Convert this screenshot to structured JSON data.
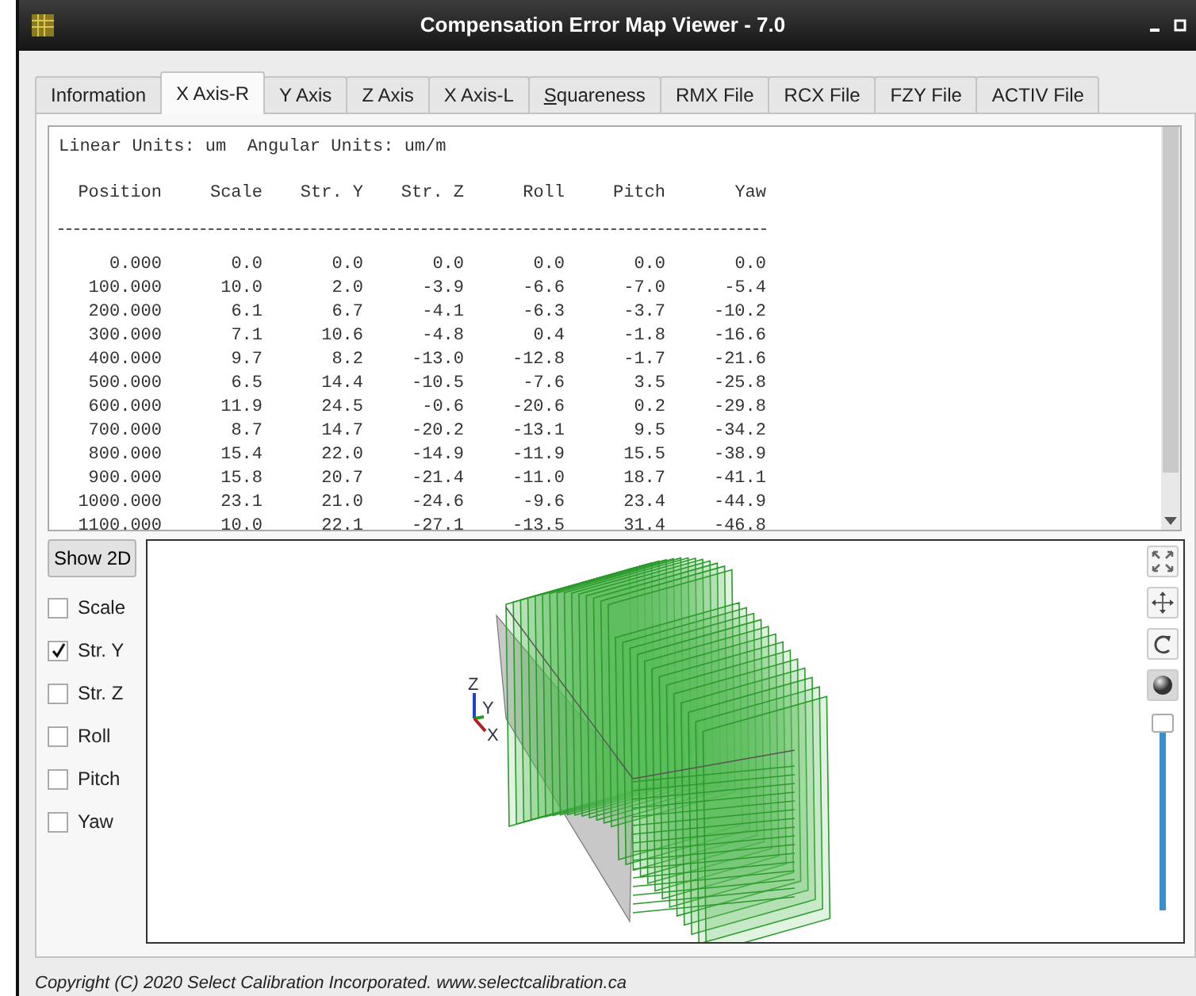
{
  "window": {
    "title": "Compensation Error Map Viewer - 7.0"
  },
  "tabs": [
    {
      "label": "Information",
      "selected": false
    },
    {
      "label": "X Axis-R",
      "selected": true
    },
    {
      "label": "Y Axis",
      "selected": false
    },
    {
      "label": "Z Axis",
      "selected": false
    },
    {
      "label": "X Axis-L",
      "selected": false
    },
    {
      "label": "Squareness",
      "selected": false,
      "mnemonic_underlined": true
    },
    {
      "label": "RMX File",
      "selected": false
    },
    {
      "label": "RCX File",
      "selected": false
    },
    {
      "label": "FZY File",
      "selected": false
    },
    {
      "label": "ACTIV File",
      "selected": false
    }
  ],
  "report": {
    "units": "Linear Units: um  Angular Units: um/m",
    "columns": [
      "Position",
      "Scale",
      "Str. Y",
      "Str. Z",
      "Roll",
      "Pitch",
      "Yaw"
    ],
    "rows": [
      [
        "0.000",
        "0.0",
        "0.0",
        "0.0",
        "0.0",
        "0.0",
        "0.0"
      ],
      [
        "100.000",
        "10.0",
        "2.0",
        "-3.9",
        "-6.6",
        "-7.0",
        "-5.4"
      ],
      [
        "200.000",
        "6.1",
        "6.7",
        "-4.1",
        "-6.3",
        "-3.7",
        "-10.2"
      ],
      [
        "300.000",
        "7.1",
        "10.6",
        "-4.8",
        "0.4",
        "-1.8",
        "-16.6"
      ],
      [
        "400.000",
        "9.7",
        "8.2",
        "-13.0",
        "-12.8",
        "-1.7",
        "-21.6"
      ],
      [
        "500.000",
        "6.5",
        "14.4",
        "-10.5",
        "-7.6",
        "3.5",
        "-25.8"
      ],
      [
        "600.000",
        "11.9",
        "24.5",
        "-0.6",
        "-20.6",
        "0.2",
        "-29.8"
      ],
      [
        "700.000",
        "8.7",
        "14.7",
        "-20.2",
        "-13.1",
        "9.5",
        "-34.2"
      ],
      [
        "800.000",
        "15.4",
        "22.0",
        "-14.9",
        "-11.9",
        "15.5",
        "-38.9"
      ],
      [
        "900.000",
        "15.8",
        "20.7",
        "-21.4",
        "-11.0",
        "18.7",
        "-41.1"
      ],
      [
        "1000.000",
        "23.1",
        "21.0",
        "-24.6",
        "-9.6",
        "23.4",
        "-44.9"
      ],
      [
        "1100.000",
        "10.0",
        "22.1",
        "-27.1",
        "-13.5",
        "31.4",
        "-46.8"
      ]
    ]
  },
  "view_button": "Show 2D",
  "series": [
    {
      "label": "Scale",
      "checked": false
    },
    {
      "label": "Str. Y",
      "checked": true
    },
    {
      "label": "Str. Z",
      "checked": false
    },
    {
      "label": "Roll",
      "checked": false
    },
    {
      "label": "Pitch",
      "checked": false
    },
    {
      "label": "Yaw",
      "checked": false
    }
  ],
  "viewer": {
    "axis_labels": [
      "Z",
      "Y",
      "X"
    ],
    "tools": [
      {
        "kind": "fit",
        "selected": false
      },
      {
        "kind": "pan",
        "selected": false
      },
      {
        "kind": "rotate",
        "selected": false
      },
      {
        "kind": "shade",
        "selected": true
      }
    ],
    "zoom": {
      "level": 1
    }
  },
  "footer": "Copyright (C) 2020 Select Calibration Incorporated.  www.selectcalibration.ca"
}
